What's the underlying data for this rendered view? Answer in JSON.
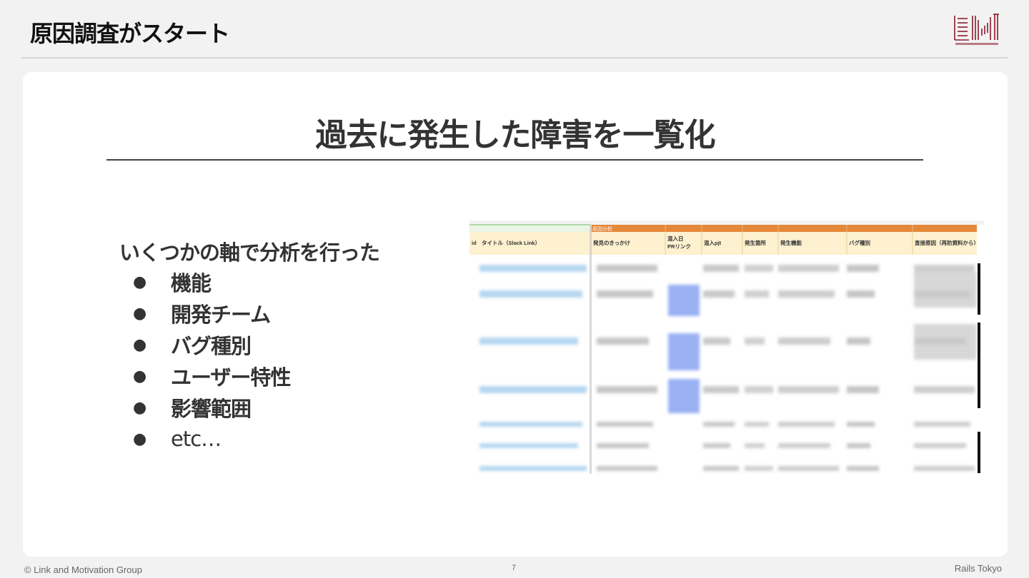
{
  "header": {
    "title": "原因調査がスタート",
    "logo_name": "link-and-motivation-group-logo",
    "brand_color": "#8b1a2b"
  },
  "card": {
    "title": "過去に発生した障害を一覧化",
    "lead": "いくつかの軸で分析を行った",
    "bullet_symbol": "●",
    "bullets": [
      {
        "text": "機能"
      },
      {
        "text": "開発チーム"
      },
      {
        "text": "バグ種別"
      },
      {
        "text": "ユーザー特性"
      },
      {
        "text": "影響範囲"
      },
      {
        "text": "etc…"
      }
    ]
  },
  "spreadsheet": {
    "group_header": "原因分析",
    "group_header_color": "#e6883a",
    "header_row_color": "#fdf1cf",
    "columns": [
      "id",
      "タイトル（Slack Link）",
      "発見のきっかけ",
      "混入日",
      "PRリンク",
      "混入pjt",
      "発生箇所",
      "発生機能",
      "バグ種別",
      "直接原因（再防資料から）"
    ]
  },
  "footer": {
    "copyright": "© Link and Motivation Group",
    "page_number": "7",
    "event": "Rails Tokyo"
  }
}
